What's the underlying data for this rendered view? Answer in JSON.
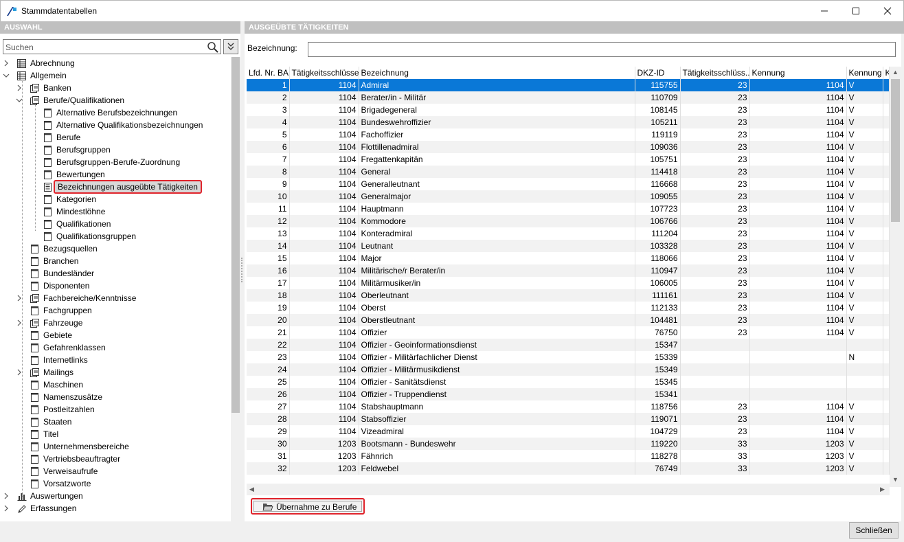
{
  "window": {
    "title": "Stammdatentabellen"
  },
  "colors": {
    "selection": "#0a78d7",
    "highlight_border": "#e0232b",
    "header_bar": "#c0c0c0"
  },
  "left": {
    "header": "AUSWAHL",
    "search_placeholder": "Suchen",
    "tree": [
      {
        "label": "Abrechnung",
        "level": 0,
        "expander": "right",
        "icon": "table-icon"
      },
      {
        "label": "Allgemein",
        "level": 0,
        "expander": "down",
        "icon": "table-icon"
      },
      {
        "label": "Banken",
        "level": 1,
        "expander": "right",
        "icon": "multi-doc-icon"
      },
      {
        "label": "Berufe/Qualifikationen",
        "level": 1,
        "expander": "down",
        "icon": "multi-doc-icon"
      },
      {
        "label": "Alternative Berufsbezeichnungen",
        "level": 2,
        "icon": "doc-icon"
      },
      {
        "label": "Alternative Qualifikationsbezeichnungen",
        "level": 2,
        "icon": "doc-icon"
      },
      {
        "label": "Berufe",
        "level": 2,
        "icon": "doc-icon"
      },
      {
        "label": "Berufsgruppen",
        "level": 2,
        "icon": "doc-icon"
      },
      {
        "label": "Berufsgruppen-Berufe-Zuordnung",
        "level": 2,
        "icon": "doc-icon"
      },
      {
        "label": "Bewertungen",
        "level": 2,
        "icon": "doc-icon"
      },
      {
        "label": "Bezeichnungen ausgeübte Tätigkeiten",
        "level": 2,
        "icon": "list-doc-icon",
        "selected": true
      },
      {
        "label": "Kategorien",
        "level": 2,
        "icon": "doc-icon"
      },
      {
        "label": "Mindestlöhne",
        "level": 2,
        "icon": "doc-icon"
      },
      {
        "label": "Qualifikationen",
        "level": 2,
        "icon": "doc-icon"
      },
      {
        "label": "Qualifikationsgruppen",
        "level": 2,
        "icon": "doc-icon"
      },
      {
        "label": "Bezugsquellen",
        "level": 1,
        "icon": "doc-icon"
      },
      {
        "label": "Branchen",
        "level": 1,
        "icon": "doc-icon"
      },
      {
        "label": "Bundesländer",
        "level": 1,
        "icon": "doc-icon"
      },
      {
        "label": "Disponenten",
        "level": 1,
        "icon": "doc-icon"
      },
      {
        "label": "Fachbereiche/Kenntnisse",
        "level": 1,
        "expander": "right",
        "icon": "multi-doc-icon"
      },
      {
        "label": "Fachgruppen",
        "level": 1,
        "icon": "doc-icon"
      },
      {
        "label": "Fahrzeuge",
        "level": 1,
        "expander": "right",
        "icon": "multi-doc-icon"
      },
      {
        "label": "Gebiete",
        "level": 1,
        "icon": "doc-icon"
      },
      {
        "label": "Gefahrenklassen",
        "level": 1,
        "icon": "doc-icon"
      },
      {
        "label": "Internetlinks",
        "level": 1,
        "icon": "doc-icon"
      },
      {
        "label": "Mailings",
        "level": 1,
        "expander": "right",
        "icon": "multi-doc-icon"
      },
      {
        "label": "Maschinen",
        "level": 1,
        "icon": "doc-icon"
      },
      {
        "label": "Namenszusätze",
        "level": 1,
        "icon": "doc-icon"
      },
      {
        "label": "Postleitzahlen",
        "level": 1,
        "icon": "doc-icon"
      },
      {
        "label": "Staaten",
        "level": 1,
        "icon": "doc-icon"
      },
      {
        "label": "Titel",
        "level": 1,
        "icon": "doc-icon"
      },
      {
        "label": "Unternehmensbereiche",
        "level": 1,
        "icon": "doc-icon"
      },
      {
        "label": "Vertriebsbeauftragter",
        "level": 1,
        "icon": "doc-icon"
      },
      {
        "label": "Verweisaufrufe",
        "level": 1,
        "icon": "doc-icon"
      },
      {
        "label": "Vorsatzworte",
        "level": 1,
        "icon": "doc-icon"
      },
      {
        "label": "Auswertungen",
        "level": 0,
        "expander": "right",
        "icon": "bar-chart-icon"
      },
      {
        "label": "Erfassungen",
        "level": 0,
        "expander": "right",
        "icon": "pencil-icon"
      }
    ]
  },
  "right": {
    "header": "AUSGEÜBTE TÄTIGKEITEN",
    "bezeichnung_label": "Bezeichnung:",
    "bezeichnung_value": "",
    "columns": [
      "Lfd. Nr. BA",
      "Tätigkeitsschlüssel",
      "Bezeichnung",
      "DKZ-ID",
      "Tätigkeitsschlüss...",
      "Kennung",
      "Kennung",
      "K"
    ],
    "rows": [
      [
        "1",
        "1104",
        "Admiral",
        "115755",
        "23",
        "1104",
        "V"
      ],
      [
        "2",
        "1104",
        "Berater/in - Militär",
        "110709",
        "23",
        "1104",
        "V"
      ],
      [
        "3",
        "1104",
        "Brigadegeneral",
        "108145",
        "23",
        "1104",
        "V"
      ],
      [
        "4",
        "1104",
        "Bundeswehroffizier",
        "105211",
        "23",
        "1104",
        "V"
      ],
      [
        "5",
        "1104",
        "Fachoffizier",
        "119119",
        "23",
        "1104",
        "V"
      ],
      [
        "6",
        "1104",
        "Flottillenadmiral",
        "109036",
        "23",
        "1104",
        "V"
      ],
      [
        "7",
        "1104",
        "Fregattenkapitän",
        "105751",
        "23",
        "1104",
        "V"
      ],
      [
        "8",
        "1104",
        "General",
        "114418",
        "23",
        "1104",
        "V"
      ],
      [
        "9",
        "1104",
        "Generalleutnant",
        "116668",
        "23",
        "1104",
        "V"
      ],
      [
        "10",
        "1104",
        "Generalmajor",
        "109055",
        "23",
        "1104",
        "V"
      ],
      [
        "11",
        "1104",
        "Hauptmann",
        "107723",
        "23",
        "1104",
        "V"
      ],
      [
        "12",
        "1104",
        "Kommodore",
        "106766",
        "23",
        "1104",
        "V"
      ],
      [
        "13",
        "1104",
        "Konteradmiral",
        "111204",
        "23",
        "1104",
        "V"
      ],
      [
        "14",
        "1104",
        "Leutnant",
        "103328",
        "23",
        "1104",
        "V"
      ],
      [
        "15",
        "1104",
        "Major",
        "118066",
        "23",
        "1104",
        "V"
      ],
      [
        "16",
        "1104",
        "Militärische/r Berater/in",
        "110947",
        "23",
        "1104",
        "V"
      ],
      [
        "17",
        "1104",
        "Militärmusiker/in",
        "106005",
        "23",
        "1104",
        "V"
      ],
      [
        "18",
        "1104",
        "Oberleutnant",
        "111161",
        "23",
        "1104",
        "V"
      ],
      [
        "19",
        "1104",
        "Oberst",
        "112133",
        "23",
        "1104",
        "V"
      ],
      [
        "20",
        "1104",
        "Oberstleutnant",
        "104481",
        "23",
        "1104",
        "V"
      ],
      [
        "21",
        "1104",
        "Offizier",
        "76750",
        "23",
        "1104",
        "V"
      ],
      [
        "22",
        "1104",
        "Offizier - Geoinformationsdienst",
        "15347",
        "",
        "",
        ""
      ],
      [
        "23",
        "1104",
        "Offizier - Militärfachlicher Dienst",
        "15339",
        "",
        "",
        "N"
      ],
      [
        "24",
        "1104",
        "Offizier - Militärmusikdienst",
        "15349",
        "",
        "",
        ""
      ],
      [
        "25",
        "1104",
        "Offizier - Sanitätsdienst",
        "15345",
        "",
        "",
        ""
      ],
      [
        "26",
        "1104",
        "Offizier - Truppendienst",
        "15341",
        "",
        "",
        ""
      ],
      [
        "27",
        "1104",
        "Stabshauptmann",
        "118756",
        "23",
        "1104",
        "V"
      ],
      [
        "28",
        "1104",
        "Stabsoffizier",
        "119071",
        "23",
        "1104",
        "V"
      ],
      [
        "29",
        "1104",
        "Vizeadmiral",
        "104729",
        "23",
        "1104",
        "V"
      ],
      [
        "30",
        "1203",
        "Bootsmann - Bundeswehr",
        "119220",
        "33",
        "1203",
        "V"
      ],
      [
        "31",
        "1203",
        "Fähnrich",
        "118278",
        "33",
        "1203",
        "V"
      ],
      [
        "32",
        "1203",
        "Feldwebel",
        "76749",
        "33",
        "1203",
        "V"
      ]
    ],
    "selected_row": 0,
    "action_button": "Übernahme zu Berufe"
  },
  "footer": {
    "close_button": "Schließen"
  }
}
